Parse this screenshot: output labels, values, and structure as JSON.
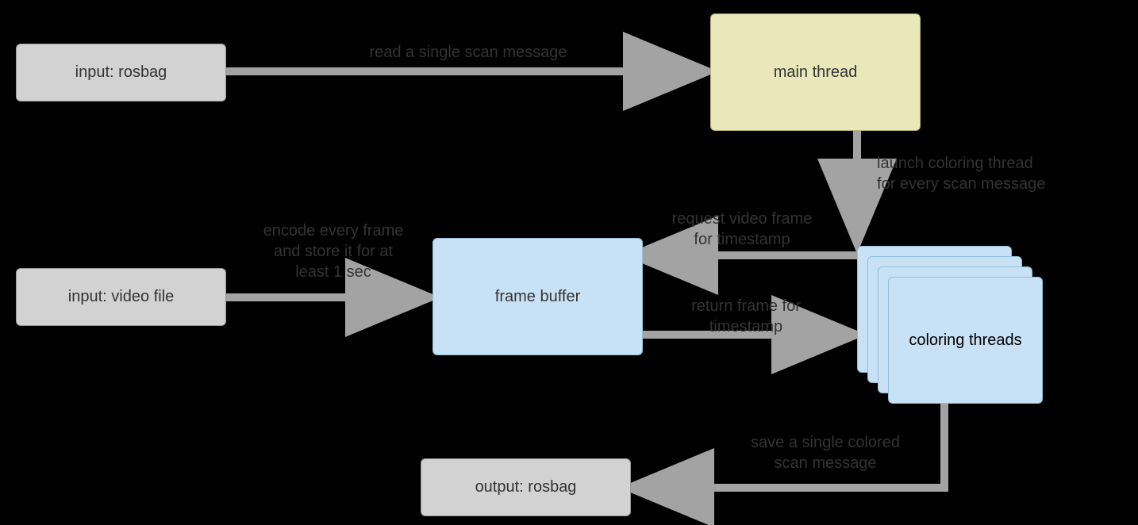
{
  "nodes": {
    "inputRosbag": "input: rosbag",
    "inputVideo": "input: video file",
    "mainThread": "main thread",
    "frameBuffer": "frame buffer",
    "coloringThreads": "coloring threads",
    "outputRosbag": "output: rosbag"
  },
  "labels": {
    "readScan": "read a single scan message",
    "launchThread": "launch coloring thread\nfor every scan message",
    "encodeFrame": "encode every frame\nand store it for at\nleast 1 sec",
    "requestFrame": "request video frame\nfor timestamp",
    "returnFrame": "return frame for\ntimestamp",
    "saveScan": "save a single colored\nscan message"
  }
}
